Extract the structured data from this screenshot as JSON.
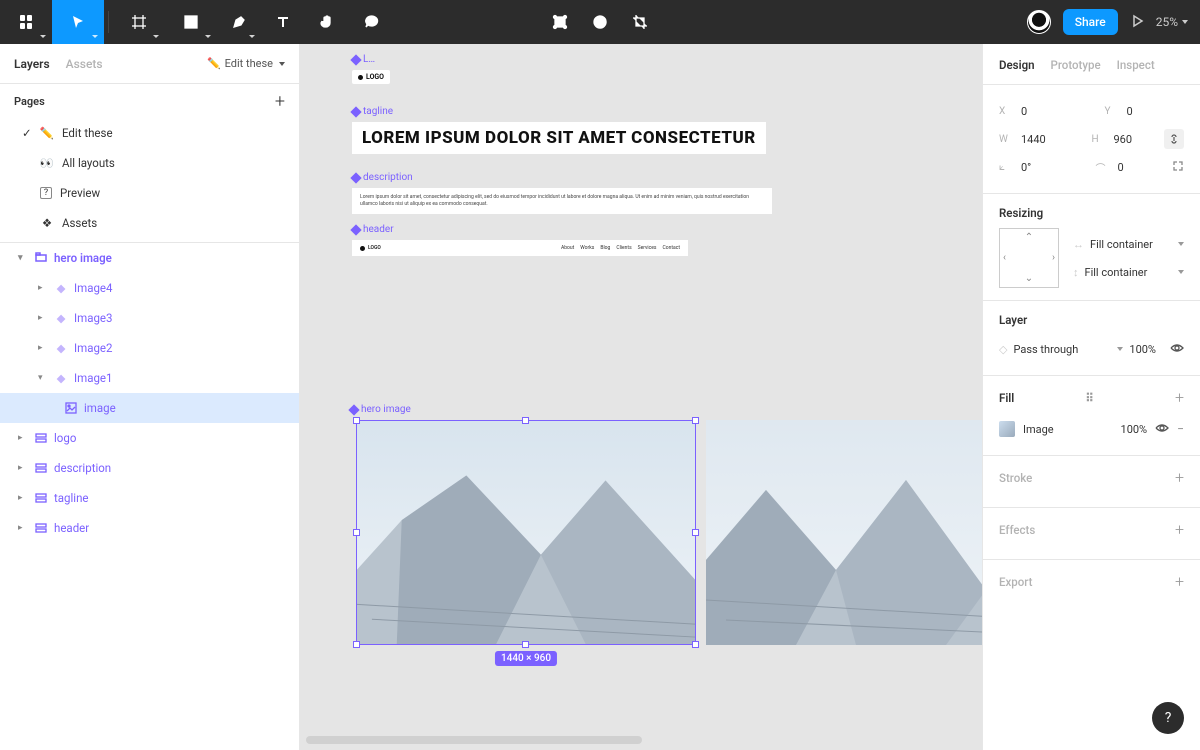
{
  "toolbar": {
    "share_label": "Share",
    "zoom": "25%"
  },
  "left_panel": {
    "tabs": {
      "layers": "Layers",
      "assets": "Assets"
    },
    "pages_dropdown": "Edit these",
    "pages_header": "Pages",
    "pages": [
      {
        "icon": "✏️",
        "label": "Edit these",
        "checked": true
      },
      {
        "icon": "👀",
        "label": "All layouts"
      },
      {
        "icon": "?",
        "label": "Preview",
        "boxed": true
      },
      {
        "icon": "❖",
        "label": "Assets"
      }
    ],
    "layers": {
      "hero_image": "hero image",
      "image4": "Image4",
      "image3": "Image3",
      "image2": "Image2",
      "image1": "Image1",
      "image": "image",
      "logo": "logo",
      "description": "description",
      "tagline": "tagline",
      "header": "header"
    }
  },
  "canvas": {
    "logo_chip": "LOGO",
    "logo_label": "L…",
    "tagline_label": "tagline",
    "tagline_text": "LOREM IPSUM DOLOR SIT AMET CONSECTETUR",
    "description_label": "description",
    "description_text": "Lorem ipsum dolor sit amet, consectetur adipiscing elit, sed do eiusmod tempor incididunt ut labore et dolore magna aliqua. Ut enim ad minim veniam, quis nostrud exercitation ullamco laboris nisi ut aliquip ex ea commodo consequat.",
    "header_label": "header",
    "header_nav": [
      "About",
      "Works",
      "Blog",
      "Clients",
      "Services",
      "Contact"
    ],
    "hero_label": "hero image",
    "selection_dims": "1440 × 960"
  },
  "right_panel": {
    "tabs": {
      "design": "Design",
      "prototype": "Prototype",
      "inspect": "Inspect"
    },
    "position": {
      "x_label": "X",
      "x_val": "0",
      "y_label": "Y",
      "y_val": "0",
      "w_label": "W",
      "w_val": "1440",
      "h_label": "H",
      "h_val": "960",
      "rot_val": "0°",
      "rad_val": "0"
    },
    "resizing_title": "Resizing",
    "resize_h": "Fill container",
    "resize_v": "Fill container",
    "layer_title": "Layer",
    "blend_mode": "Pass through",
    "opacity": "100%",
    "fill_title": "Fill",
    "fill_type": "Image",
    "fill_opacity": "100%",
    "stroke_title": "Stroke",
    "effects_title": "Effects",
    "export_title": "Export"
  },
  "help": "?"
}
